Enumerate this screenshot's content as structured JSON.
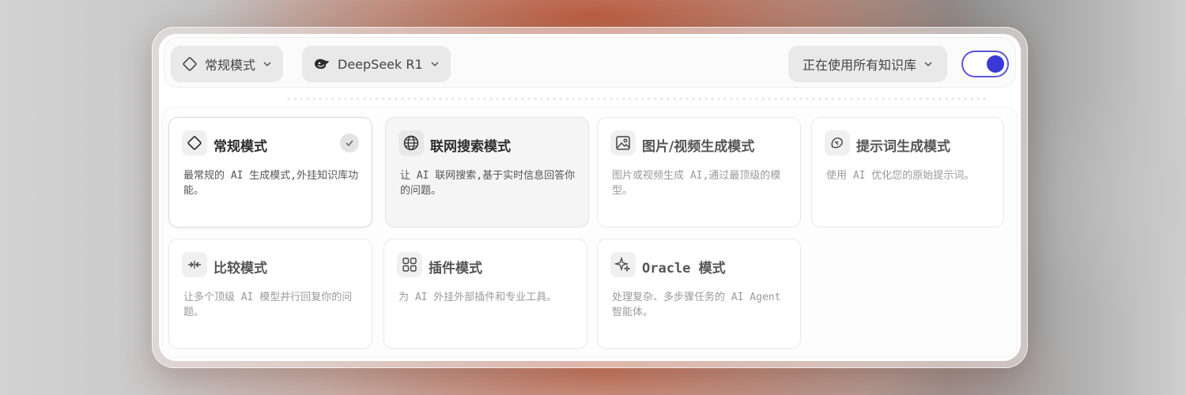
{
  "topbar": {
    "mode_selector": {
      "label": "常规模式",
      "icon": "diamond-icon"
    },
    "model_selector": {
      "label": "DeepSeek R1",
      "icon": "deepseek-whale-icon"
    },
    "knowledge_selector": {
      "label": "正在使用所有知识库"
    },
    "toggle": {
      "state": "on",
      "color": "#3b38d6"
    }
  },
  "modes": [
    {
      "title": "常规模式",
      "description": "最常规的 AI 生成模式,外挂知识库功能。",
      "icon": "diamond-icon",
      "selected": true
    },
    {
      "title": "联网搜索模式",
      "description": "让 AI 联网搜索,基于实时信息回答你的问题。",
      "icon": "globe-icon",
      "hovered": true
    },
    {
      "title": "图片/视频生成模式",
      "description": "图片或视频生成 AI,通过最顶级的模型。",
      "icon": "image-icon"
    },
    {
      "title": "提示词生成模式",
      "description": "使用 AI 优化您的原始提示词。",
      "icon": "wand-icon"
    },
    {
      "title": "比较模式",
      "description": "让多个顶级 AI 模型并行回复你的问题。",
      "icon": "compare-arrows-icon"
    },
    {
      "title": "插件模式",
      "description": "为 AI 外挂外部插件和专业工具。",
      "icon": "grid-icon"
    },
    {
      "title": "Oracle 模式",
      "description": "处理复杂、多步骤任务的 AI Agent 智能体。",
      "icon": "sparkle-icon"
    }
  ],
  "colors": {
    "accent": "#3b38d6",
    "background_warm": "#c0684f"
  }
}
